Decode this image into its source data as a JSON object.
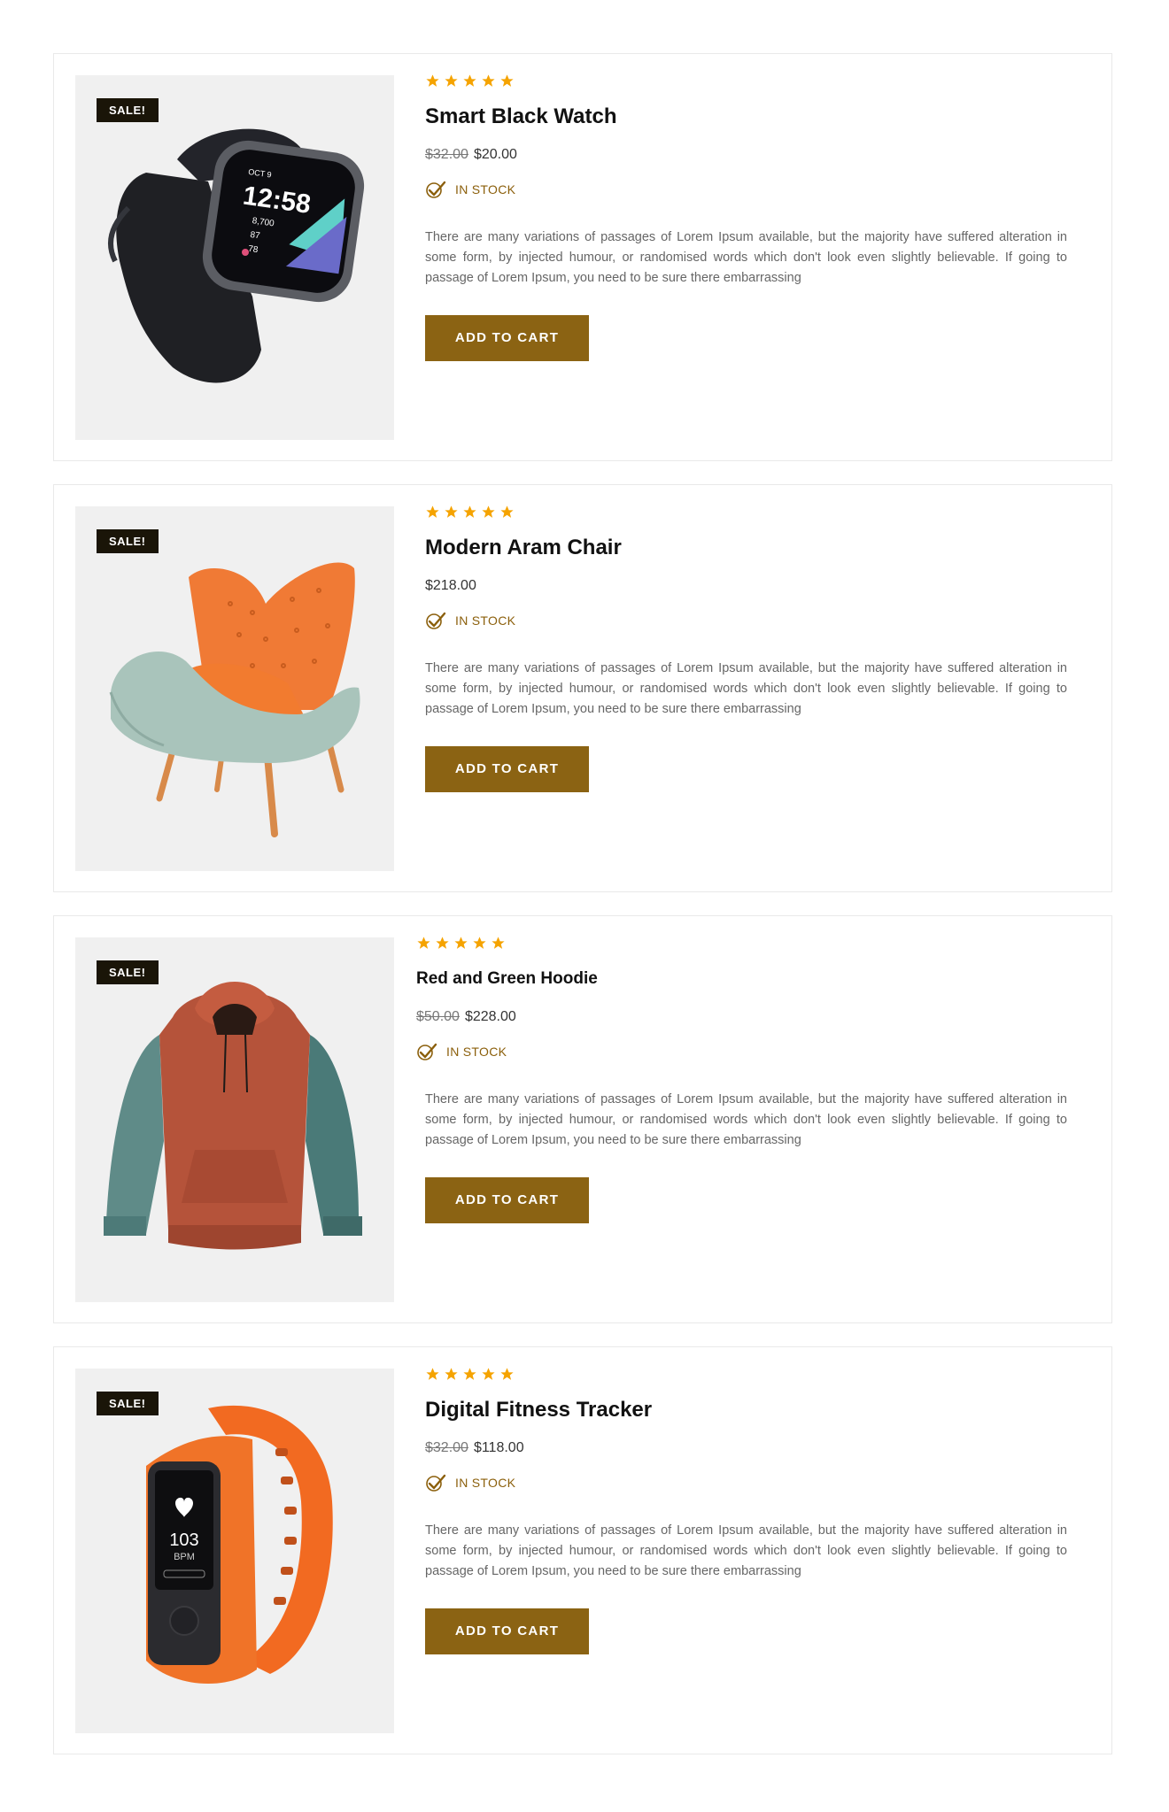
{
  "colors": {
    "accent": "#8b6313",
    "star": "#f5a300",
    "stock": "#8b5f0b",
    "badge_bg": "#1a1508",
    "image_bg": "#f0f0f0"
  },
  "products": [
    {
      "sale_badge": "SALE!",
      "rating": 5,
      "title": "Smart Black Watch",
      "old_price": "$32.00",
      "price": "$20.00",
      "stock": "IN STOCK",
      "description": "There are many variations of passages of Lorem Ipsum available, but the majority have suffered alteration in some form, by injected humour, or randomised words which don't look even slightly believable. If going to passage of Lorem Ipsum, you need to be sure there embarrassing",
      "button": "ADD TO CART",
      "image_icon": "smartwatch-image",
      "watch_date": "OCT 9",
      "watch_time": "12:58",
      "watch_steps": "8,700",
      "watch_stat2": "87",
      "watch_heart": "78"
    },
    {
      "sale_badge": "SALE!",
      "rating": 5,
      "title": "Modern Aram Chair",
      "old_price": "",
      "price": "$218.00",
      "stock": "IN STOCK",
      "description": "There are many variations of passages of Lorem Ipsum available, but the majority have suffered alteration in some form, by injected humour, or randomised words which don't look even slightly believable. If going to passage of Lorem Ipsum, you need to be sure there embarrassing",
      "button": "ADD TO CART",
      "image_icon": "armchair-image"
    },
    {
      "sale_badge": "SALE!",
      "rating": 5,
      "title": "Red and Green Hoodie",
      "old_price": "$50.00",
      "price": "$228.00",
      "stock": "IN STOCK",
      "description": "There are many variations of passages of Lorem Ipsum available, but the majority have suffered alteration in some form, by injected humour, or randomised words which don't look even slightly believable. If going to passage of Lorem Ipsum, you need to be sure there embarrassing",
      "button": "ADD TO CART",
      "image_icon": "hoodie-image"
    },
    {
      "sale_badge": "SALE!",
      "rating": 5,
      "title": "Digital Fitness Tracker",
      "old_price": "$32.00",
      "price": "$118.00",
      "stock": "IN STOCK",
      "description": "There are many variations of passages of Lorem Ipsum available, but the majority have suffered alteration in some form, by injected humour, or randomised words which don't look even slightly believable. If going to passage of Lorem Ipsum, you need to be sure there embarrassing",
      "button": "ADD TO CART",
      "image_icon": "fitness-tracker-image",
      "tracker_value": "103",
      "tracker_unit": "BPM"
    }
  ]
}
